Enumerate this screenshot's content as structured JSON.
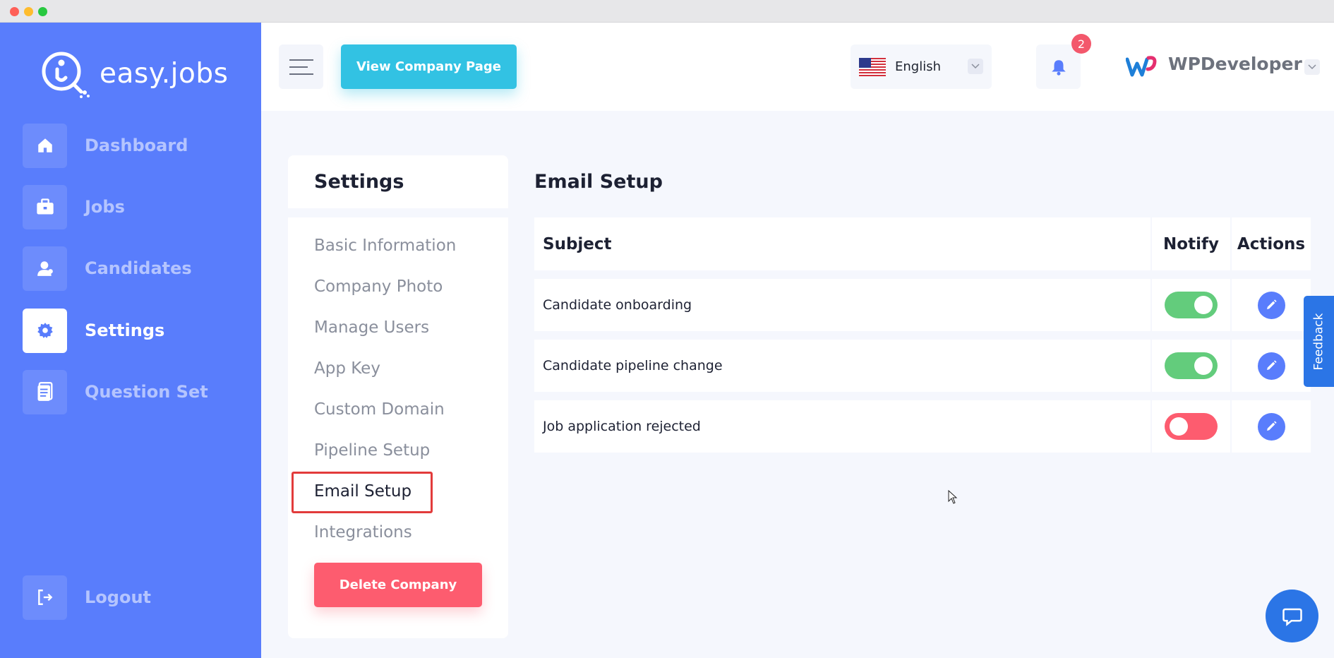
{
  "app": {
    "logo_text": "easy.jobs"
  },
  "sidebar": {
    "items": [
      {
        "label": "Dashboard",
        "icon": "home-icon"
      },
      {
        "label": "Jobs",
        "icon": "briefcase-icon"
      },
      {
        "label": "Candidates",
        "icon": "user-icon"
      },
      {
        "label": "Settings",
        "icon": "gear-icon",
        "active": true
      },
      {
        "label": "Question Set",
        "icon": "document-icon"
      }
    ],
    "logout_label": "Logout"
  },
  "topbar": {
    "view_company_label": "View Company Page",
    "language": "English",
    "notification_count": "2",
    "company_name": "WPDeveloper"
  },
  "settings": {
    "title": "Settings",
    "menu": [
      "Basic Information",
      "Company Photo",
      "Manage Users",
      "App Key",
      "Custom Domain",
      "Pipeline Setup",
      "Email Setup",
      "Integrations"
    ],
    "active_item": "Email Setup",
    "delete_label": "Delete Company"
  },
  "email_setup": {
    "title": "Email Setup",
    "columns": {
      "subject": "Subject",
      "notify": "Notify",
      "actions": "Actions"
    },
    "rows": [
      {
        "subject": "Candidate onboarding",
        "notify": true
      },
      {
        "subject": "Candidate pipeline change",
        "notify": true
      },
      {
        "subject": "Job application rejected",
        "notify": false
      }
    ]
  },
  "feedback_label": "Feedback",
  "colors": {
    "sidebar": "#597dfc",
    "accent_cyan": "#32c2e3",
    "danger": "#fd5c6f",
    "toggle_on": "#63cc7c",
    "highlight_border": "#e23b3b",
    "feedback_blue": "#2b75e6"
  }
}
